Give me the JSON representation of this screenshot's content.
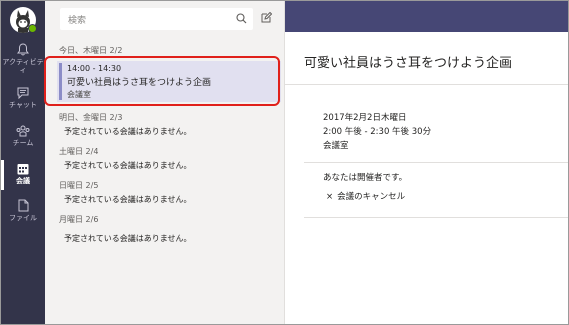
{
  "rail": {
    "items": [
      {
        "label": "アクティビティ",
        "icon": "bell-icon"
      },
      {
        "label": "チャット",
        "icon": "chat-icon"
      },
      {
        "label": "チーム",
        "icon": "teams-icon"
      },
      {
        "label": "会議",
        "icon": "calendar-icon",
        "active": true
      },
      {
        "label": "ファイル",
        "icon": "file-icon"
      }
    ]
  },
  "search": {
    "placeholder": "検索"
  },
  "agenda": {
    "days": [
      {
        "label": "今日、木曜日 2/2"
      },
      {
        "label": "明日、金曜日 2/3",
        "empty": "予定されている会議はありません。"
      },
      {
        "label": "土曜日 2/4",
        "empty": "予定されている会議はありません。"
      },
      {
        "label": "日曜日 2/5",
        "empty": "予定されている会議はありません。"
      },
      {
        "label": "月曜日 2/6",
        "empty": "予定されている会議はありません。"
      }
    ],
    "meeting": {
      "time": "14:00 - 14:30",
      "title": "可愛い社員はうさ耳をつけよう企画",
      "location": "会議室"
    }
  },
  "detail": {
    "title": "可愛い社員はうさ耳をつけよう企画",
    "date": "2017年2月2日木曜日",
    "time": "2:00 午後 - 2:30 午後 30分",
    "location": "会議室",
    "role": "あなたは開催者です。",
    "cancel_label": "会議のキャンセル"
  },
  "colors": {
    "rail": "#33344a",
    "topbar": "#464775",
    "selected": "#e1e0f0",
    "highlight": "#e0201b",
    "presence": "#6bb700"
  }
}
